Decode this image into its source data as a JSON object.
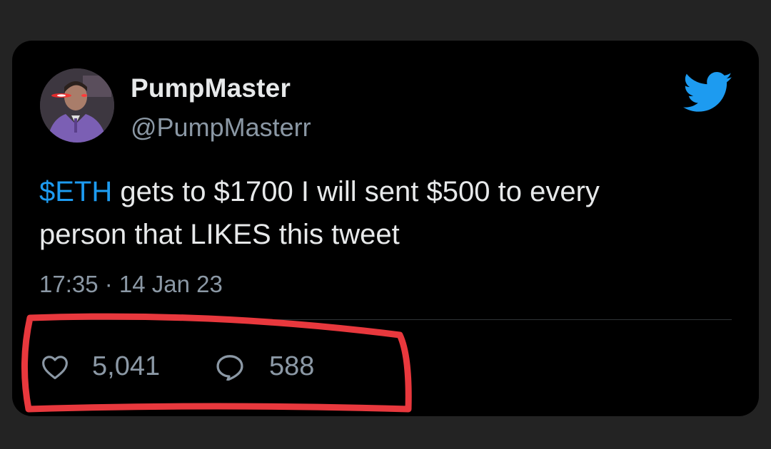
{
  "tweet": {
    "display_name": "PumpMaster",
    "handle": "@PumpMasterr",
    "cashtag": "$ETH",
    "text_line1_rest": " gets to $1700 I will sent $500 to every",
    "text_line2": "person that LIKES this tweet",
    "timestamp": "17:35 · 14 Jan 23",
    "likes": "5,041",
    "replies": "588"
  },
  "icons": {
    "brand": "twitter-bird-icon",
    "like": "heart-icon",
    "reply": "speech-bubble-icon"
  },
  "colors": {
    "background": "#232323",
    "card": "#000000",
    "primary_text": "#e7e9ea",
    "secondary_text": "#8b98a5",
    "accent": "#1d9bf0",
    "annotation": "#e8383d"
  }
}
